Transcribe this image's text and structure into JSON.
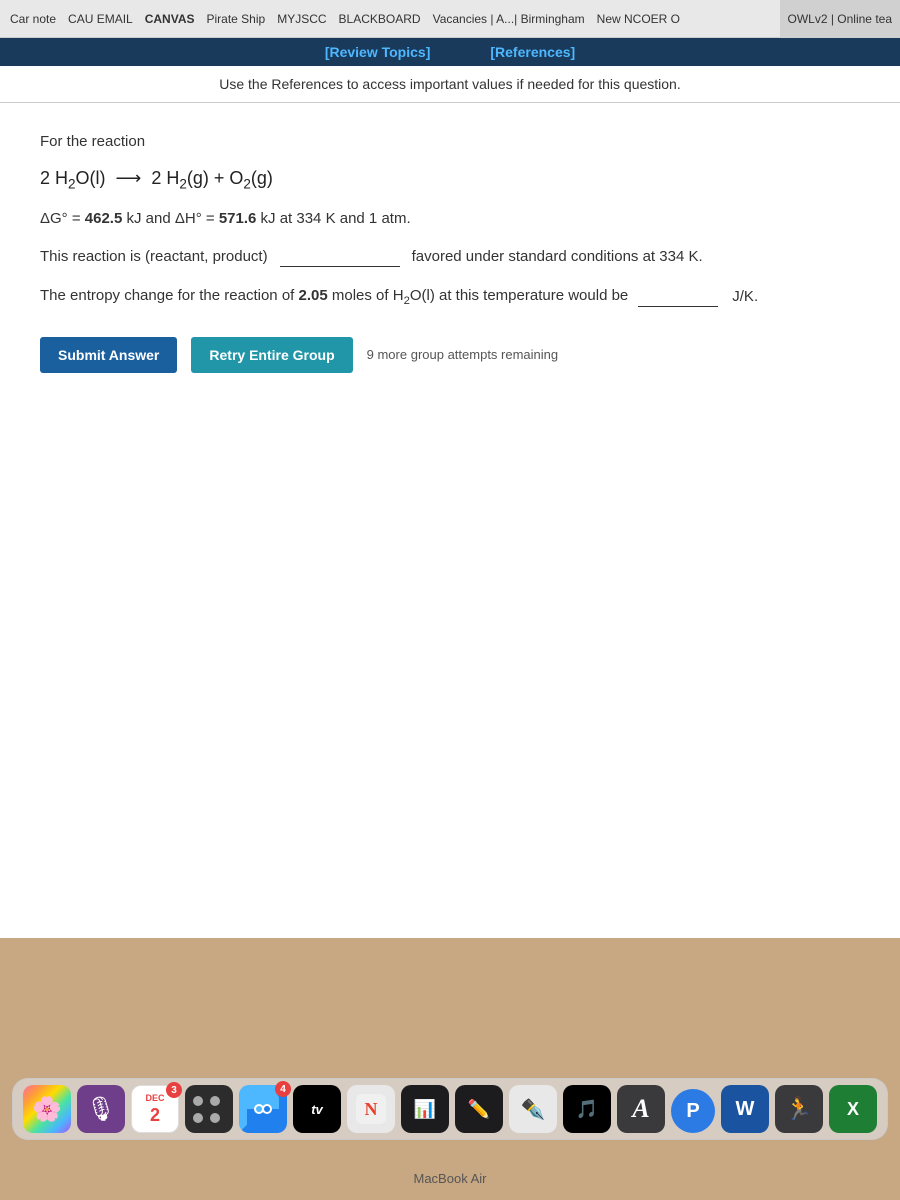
{
  "browser": {
    "items": [
      {
        "id": "car-note",
        "label": "Car note"
      },
      {
        "id": "cau-email",
        "label": "CAU EMAIL"
      },
      {
        "id": "canvas",
        "label": "CANVAS"
      },
      {
        "id": "pirate-ship",
        "label": "Pirate Ship"
      },
      {
        "id": "myjscc",
        "label": "MYJSCC"
      },
      {
        "id": "blackboard",
        "label": "BLACKBOARD"
      },
      {
        "id": "vacancies",
        "label": "Vacancies | A...| Birmingham"
      },
      {
        "id": "new-ncoer",
        "label": "New NCOER O"
      }
    ],
    "owlv2_label": "OWLv2 | Online tea"
  },
  "linkbar": {
    "review_topics": "[Review Topics]",
    "references": "[References]"
  },
  "ref_note": "Use the References to access important values if needed for this question.",
  "question": {
    "for_the_reaction": "For the reaction",
    "reaction_left": "2 H₂O(l)",
    "reaction_arrow": "⟶",
    "reaction_right": "2 H₂(g) + O₂(g)",
    "thermodynamics": "ΔG° = 462.5 kJ and ΔH° = 571.6 kJ at 334 K and 1 atm.",
    "question1_pre": "This reaction is (reactant, product)",
    "question1_post": "favored under standard conditions at 334 K.",
    "question2_pre": "The entropy change for the reaction of 2.05 moles of H₂O(l) at this temperature would be",
    "question2_post": "J/K.",
    "submit_label": "Submit Answer",
    "retry_label": "Retry Entire Group",
    "attempts_text": "9 more group attempts remaining"
  },
  "dock": {
    "calendar_month": "DEC",
    "calendar_day": "2",
    "tv_label": "tv",
    "macbook_label": "MacBook Air",
    "badge_calendar": "3",
    "badge_finder": "4"
  }
}
